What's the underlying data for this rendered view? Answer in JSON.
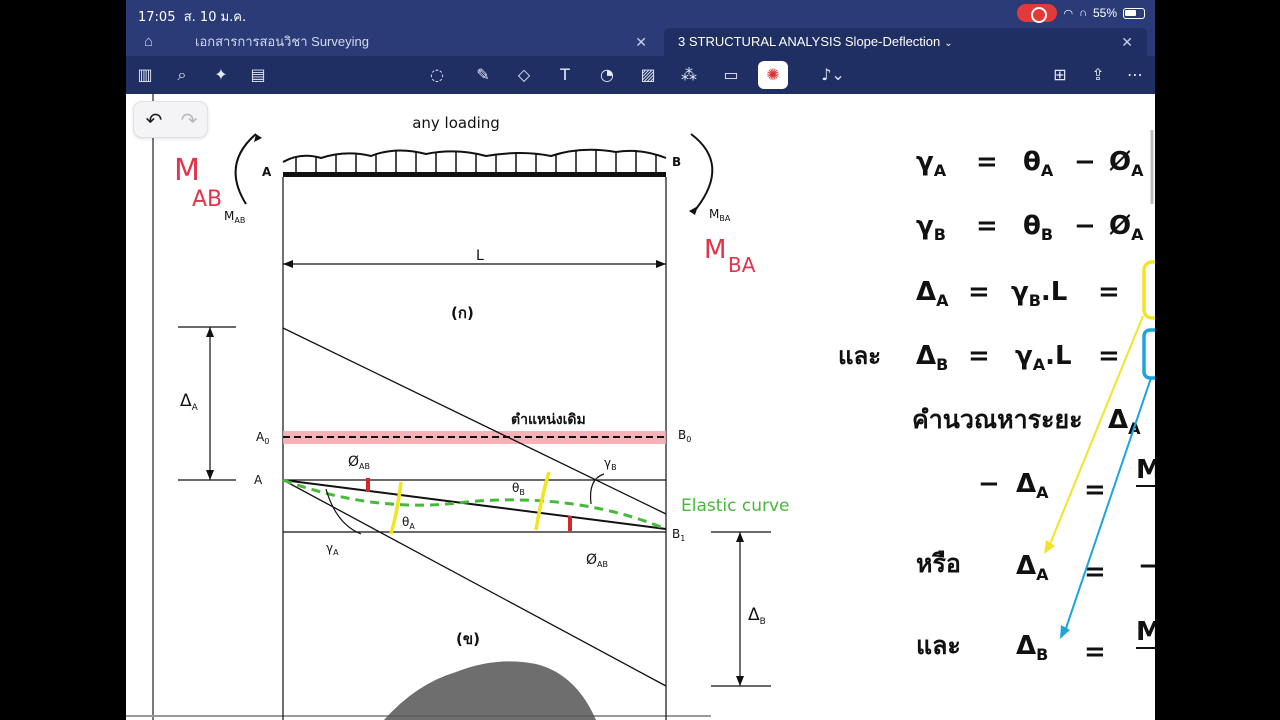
{
  "status": {
    "time": "17:05",
    "date": "ส. 10 ม.ค.",
    "battery": "55%"
  },
  "tabs": [
    {
      "label": "เอกสารการสอนวิชา Surveying"
    },
    {
      "label": "3 STRUCTURAL  ANALYSIS Slope-Deflection"
    }
  ],
  "toolbar": {
    "icons": [
      "sidebar-icon",
      "search-icon",
      "sparkle-icon",
      "document-icon",
      "lasso-icon",
      "pen-icon",
      "eraser-icon",
      "text-box-icon",
      "shape-icon",
      "image-icon",
      "stickers-icon",
      "sticky-note-icon",
      "laser-pointer-icon",
      "microphone-icon",
      "add-page-icon",
      "share-icon",
      "more-icon"
    ]
  },
  "diagram": {
    "load_label": "any loading",
    "support_a": "A",
    "support_b": "B",
    "moment_ab": "M",
    "moment_ab_sub": "AB",
    "moment_ba": "M",
    "moment_ba_sub": "BA",
    "span_label": "L",
    "fig_a": "(ก)",
    "fig_b": "(ข)",
    "delta_a": "Δ",
    "delta_a_sub": "A",
    "delta_b": "Δ",
    "delta_b_sub": "B",
    "original_pos": "ตำแหน่งเดิม",
    "a0": "A",
    "a0_sub": "0",
    "b0": "B",
    "b0_sub": "0",
    "a1": "A",
    "b1": "B",
    "b1_sub": "1",
    "phi_ab_top": "Ø",
    "phi_ab_top_sub": "AB",
    "phi_ab_bottom": "Ø",
    "phi_ab_bottom_sub": "AB",
    "theta_a": "θ",
    "theta_a_sub": "A",
    "theta_b": "θ",
    "theta_b_sub": "B",
    "gamma_a": "γ",
    "gamma_a_sub": "A",
    "gamma_b": "γ",
    "gamma_b_sub": "B",
    "elastic_curve": "Elastic curve",
    "hw_m_ab": "M",
    "hw_m_ab_sub": "AB",
    "hw_m_ba": "M",
    "hw_m_ba_sub": "BA"
  },
  "equations": {
    "eq1_lhs": "γ",
    "eq1_lhs_sub": "A",
    "eq1_rhs": "θ",
    "eq1_rhs_sub": "A",
    "eq1_phi": "Ø",
    "eq1_phi_sub": "A",
    "eq2_lhs": "γ",
    "eq2_lhs_sub": "B",
    "eq2_rhs": "θ",
    "eq2_rhs_sub": "B",
    "eq2_phi": "Ø",
    "eq2_phi_sub": "A",
    "eq3_lhs": "Δ",
    "eq3_lhs_sub": "A",
    "eq3_gamma": "γ",
    "eq3_gamma_sub": "B",
    "eq3_l": ".L",
    "and_1": "และ",
    "eq4_lhs": "Δ",
    "eq4_lhs_sub": "B",
    "eq4_gamma": "γ",
    "eq4_gamma_sub": "A",
    "eq4_l": ".L",
    "calc_text": "คำนวณหาระยะ",
    "calc_delta": "Δ",
    "calc_delta_sub": "A",
    "eq5_minus": "−",
    "eq5_lhs": "Δ",
    "eq5_lhs_sub": "A",
    "eq5_m": "M",
    "or_text": "หรือ",
    "eq6_lhs": "Δ",
    "eq6_lhs_sub": "A",
    "and_2": "และ",
    "eq7_lhs": "Δ",
    "eq7_lhs_sub": "B",
    "eq7_m": "M",
    "equals": "=",
    "minus": "−"
  }
}
